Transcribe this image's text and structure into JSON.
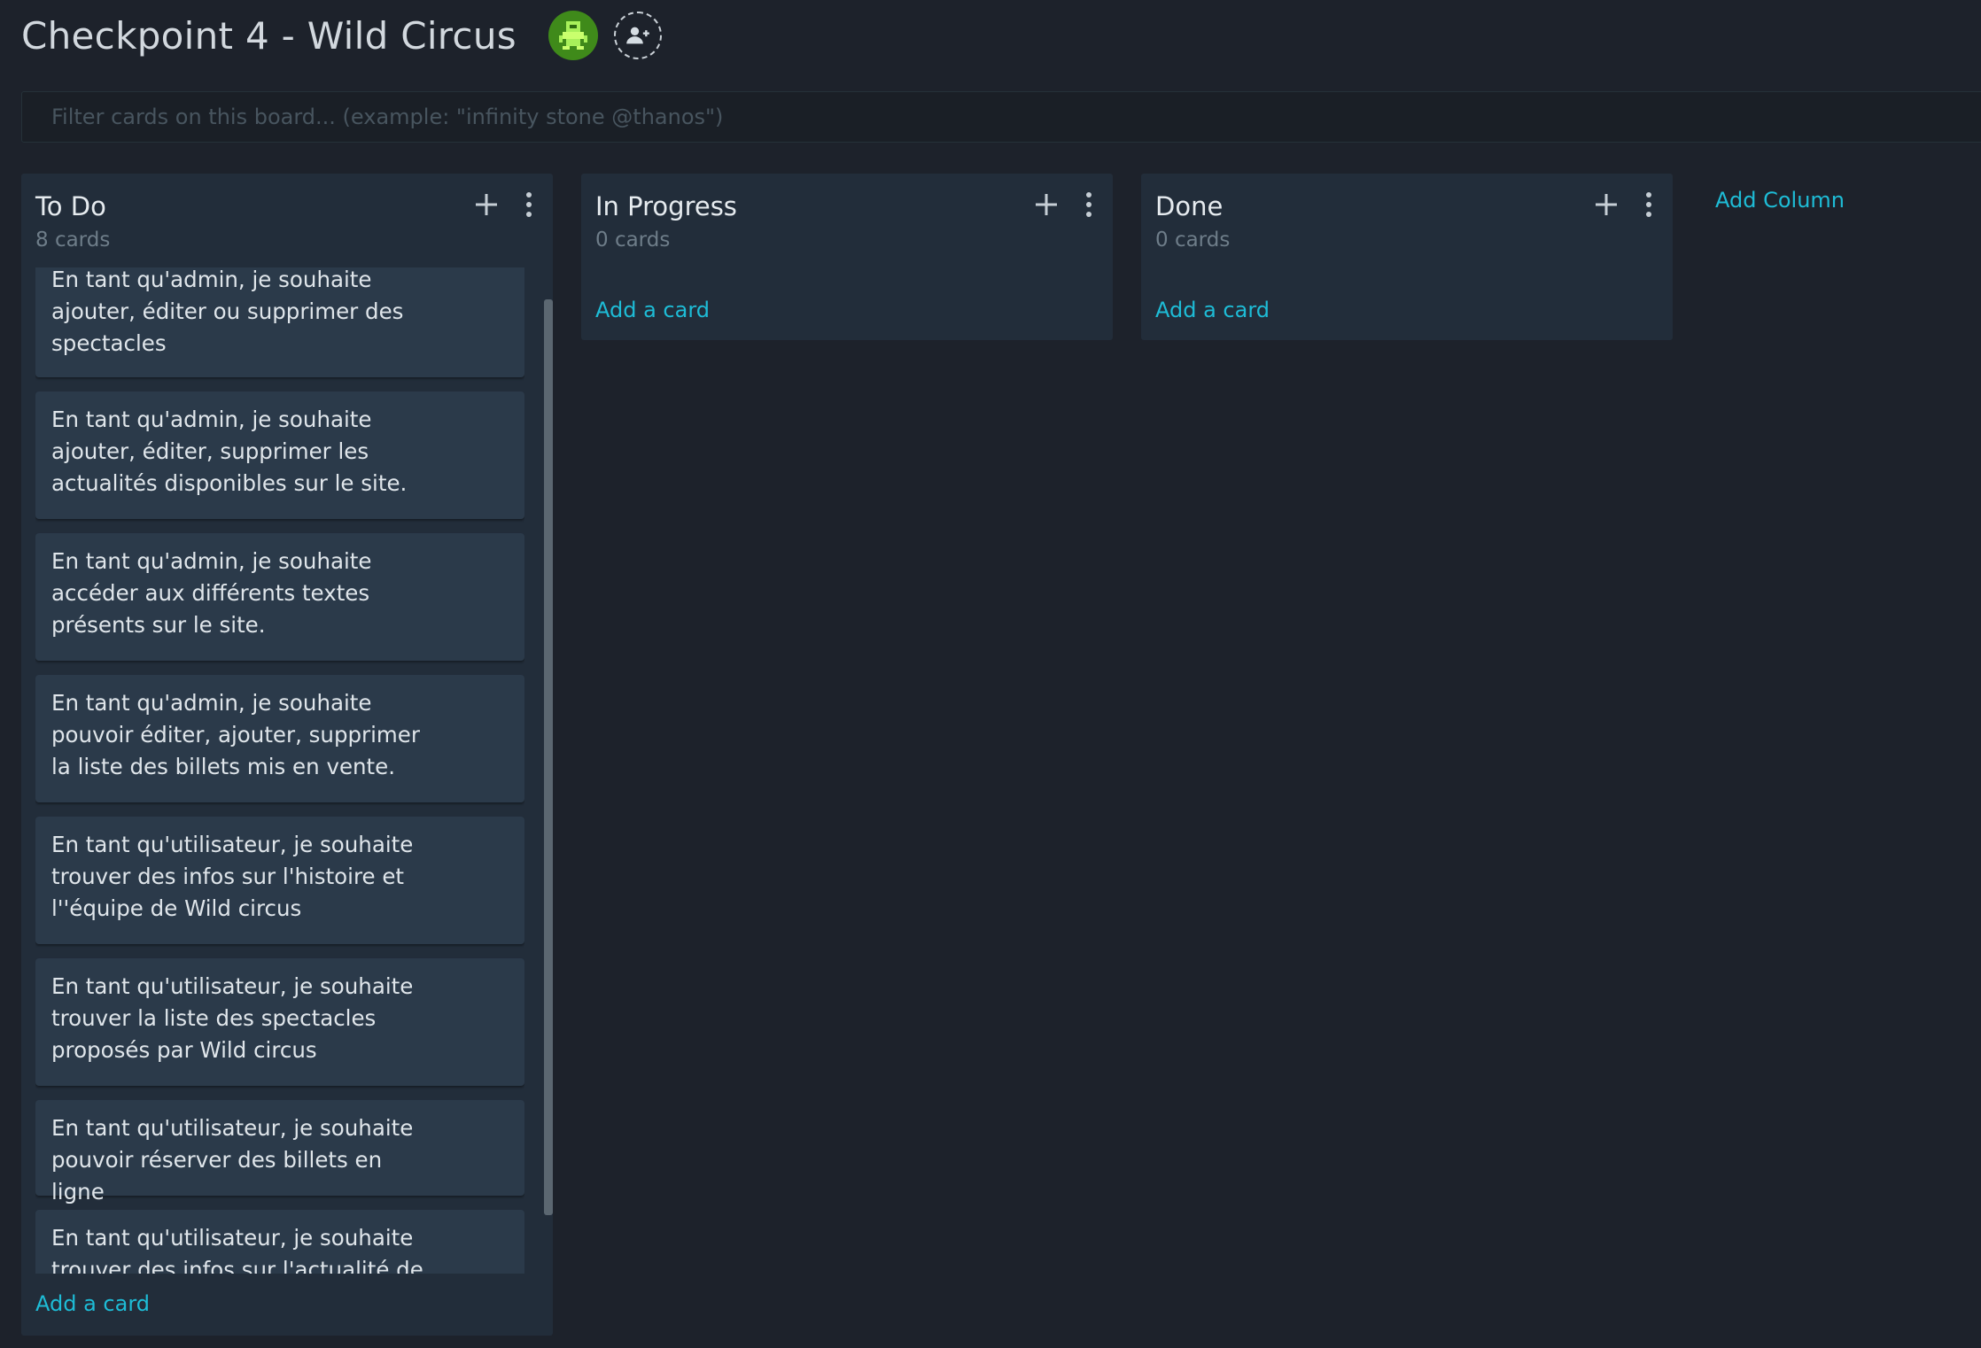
{
  "board": {
    "title": "Checkpoint 4 - Wild Circus",
    "filter_placeholder": "Filter cards on this board... (example: \"infinity stone @thanos\")"
  },
  "columns": [
    {
      "title": "To Do",
      "count": "8 cards",
      "add_card": "Add a card",
      "cards": [
        "En tant qu'admin, je souhaite ajouter, éditer ou supprimer des spectacles",
        "En tant qu'admin, je souhaite ajouter, éditer, supprimer les actualités disponibles sur le site.",
        "En tant qu'admin, je souhaite accéder aux différents textes présents sur le site.",
        "En tant qu'admin, je souhaite pouvoir éditer, ajouter, supprimer la liste des billets mis en vente.",
        "En tant qu'utilisateur, je souhaite trouver des infos sur l'histoire et l''équipe de Wild circus",
        "En tant qu'utilisateur, je souhaite trouver la liste des spectacles proposés par Wild circus",
        "En tant qu'utilisateur, je souhaite pouvoir réserver des billets en ligne",
        "En tant qu'utilisateur, je souhaite trouver des infos sur l'actualité de"
      ]
    },
    {
      "title": "In Progress",
      "count": "0 cards",
      "add_card": "Add a card"
    },
    {
      "title": "Done",
      "count": "0 cards",
      "add_card": "Add a card"
    }
  ],
  "add_column": "Add Column",
  "colors": {
    "background": "#1d222b",
    "column": "#222d3a",
    "card": "#2b3a4a",
    "accent": "#1ebcd6",
    "avatar": "#3f8a1a"
  },
  "icons": {
    "avatar": "pixel-robot-avatar-icon",
    "add_member": "add-user-icon",
    "add": "plus-icon",
    "more": "vertical-dots-icon"
  }
}
